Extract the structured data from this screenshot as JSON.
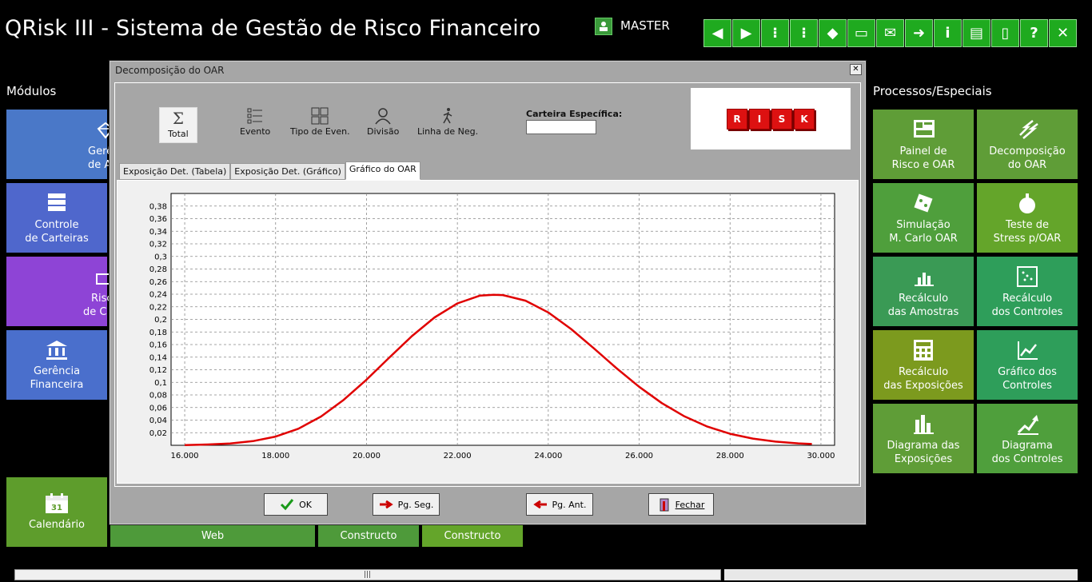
{
  "app": {
    "title": "QRisk III - Sistema de Gestão de Risco Financeiro",
    "user": "MASTER"
  },
  "toolbar": [
    {
      "name": "back-icon",
      "glyph": "◀"
    },
    {
      "name": "forward-icon",
      "glyph": "▶"
    },
    {
      "name": "traffic-light-icon",
      "glyph": "⁝"
    },
    {
      "name": "traffic-light-2-icon",
      "glyph": "⁝"
    },
    {
      "name": "paint-bucket-icon",
      "glyph": "◆"
    },
    {
      "name": "monitor-icon",
      "glyph": "▭"
    },
    {
      "name": "mail-icon",
      "glyph": "✉"
    },
    {
      "name": "send-icon",
      "glyph": "➜"
    },
    {
      "name": "info-icon",
      "glyph": "i"
    },
    {
      "name": "document-icon",
      "glyph": "▤"
    },
    {
      "name": "exit-door-icon",
      "glyph": "▯"
    },
    {
      "name": "help-icon",
      "glyph": "?"
    },
    {
      "name": "close-icon",
      "glyph": "✕"
    }
  ],
  "left": {
    "title": "Módulos",
    "tiles": [
      {
        "line1": "Gerê",
        "line2": "de A"
      },
      {
        "line1": "Controle",
        "line2": "de Carteiras"
      },
      {
        "line1": "Risc",
        "line2": "de  C"
      },
      {
        "line1": "Gerência",
        "line2": "Financeira"
      }
    ],
    "calendar": "Calendário",
    "bottom": [
      "Web",
      "Constructo",
      "Constructo"
    ]
  },
  "right": {
    "title": "Processos/Especiais",
    "tiles": [
      {
        "line1": "Painel de",
        "line2": "Risco e OAR",
        "color": "#5f9d37"
      },
      {
        "line1": "Decomposição",
        "line2": "do OAR",
        "color": "#5f9d37"
      },
      {
        "line1": "Simulação",
        "line2": "M. Carlo OAR",
        "color": "#4f9f3c"
      },
      {
        "line1": "Teste de",
        "line2": "Stress p/OAR",
        "color": "#64a52a"
      },
      {
        "line1": "Recálculo",
        "line2": "das Amostras",
        "color": "#3a9a55"
      },
      {
        "line1": "Recálculo",
        "line2": "dos Controles",
        "color": "#2e9e5a"
      },
      {
        "line1": "Recálculo",
        "line2": "das Exposições",
        "color": "#7c9a1e"
      },
      {
        "line1": "Gráfico dos",
        "line2": "Controles",
        "color": "#2e9e5a"
      },
      {
        "line1": "Diagrama das",
        "line2": "Exposições",
        "color": "#5f9d37"
      },
      {
        "line1": "Diagrama",
        "line2": "dos Controles",
        "color": "#4f9f3c"
      }
    ]
  },
  "dialog": {
    "title": "Decomposição do OAR",
    "tools": [
      "Total",
      "Evento",
      "Tipo de Even.",
      "Divisão",
      "Linha de Neg."
    ],
    "carteira_label": "Carteira Específica:",
    "carteira_value": "",
    "logo_letters": [
      "R",
      "I",
      "S",
      "K"
    ],
    "tabs": [
      "Exposição Det. (Tabela)",
      "Exposição Det. (Gráfico)",
      "Gráfico do OAR"
    ],
    "buttons": {
      "ok": "OK",
      "next": "Pg. Seg.",
      "prev": "Pg. Ant.",
      "close": "Fechar"
    }
  },
  "chart_data": {
    "type": "line",
    "title": "",
    "xlabel": "",
    "ylabel": "",
    "xlim": [
      15700,
      30300
    ],
    "ylim": [
      0,
      0.4
    ],
    "x_ticks": [
      "16.000",
      "18.000",
      "20.000",
      "22.000",
      "24.000",
      "26.000",
      "28.000",
      "30.000"
    ],
    "y_ticks": [
      "0,02",
      "0,04",
      "0,06",
      "0,08",
      "0,1",
      "0,12",
      "0,14",
      "0,16",
      "0,18",
      "0,2",
      "0,22",
      "0,24",
      "0,26",
      "0,28",
      "0,3",
      "0,32",
      "0,34",
      "0,36",
      "0,38"
    ],
    "grid": true,
    "series": [
      {
        "color": "#e00000",
        "x": [
          16000,
          16500,
          17000,
          17500,
          18000,
          18500,
          19000,
          19500,
          20000,
          20500,
          21000,
          21500,
          22000,
          22500,
          22800,
          23000,
          23500,
          24000,
          24500,
          25000,
          25500,
          26000,
          26500,
          27000,
          27500,
          28000,
          28500,
          29000,
          29500,
          29800
        ],
        "y": [
          0.0003,
          0.0013,
          0.0029,
          0.0066,
          0.0138,
          0.0263,
          0.0457,
          0.0722,
          0.1042,
          0.1392,
          0.1734,
          0.2032,
          0.2254,
          0.2378,
          0.239,
          0.2386,
          0.2297,
          0.211,
          0.1848,
          0.1542,
          0.1226,
          0.093,
          0.0669,
          0.0458,
          0.0297,
          0.0183,
          0.0107,
          0.0059,
          0.0031,
          0.002
        ]
      }
    ]
  }
}
